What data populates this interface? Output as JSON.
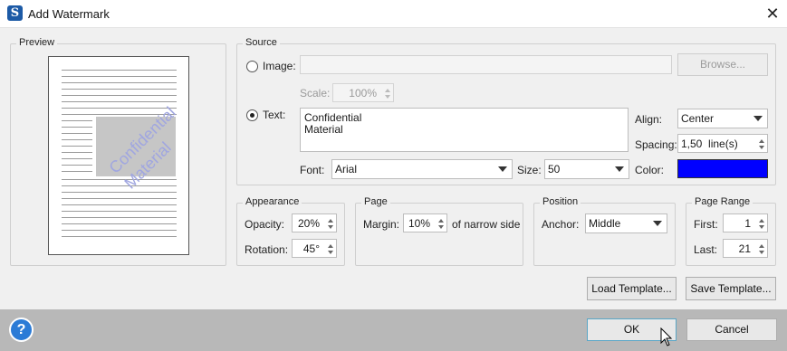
{
  "window": {
    "title": "Add Watermark",
    "app_icon_glyph": "S"
  },
  "preview": {
    "legend": "Preview",
    "watermark_lines": [
      "Confidential",
      "Material"
    ],
    "watermark_color": "#a0a6e0"
  },
  "source": {
    "legend": "Source",
    "image_label": "Image:",
    "image_path": "",
    "browse_label": "Browse...",
    "scale_label": "Scale:",
    "scale_value": "100%",
    "text_label": "Text:",
    "text_value": "Confidential\nMaterial",
    "align_label": "Align:",
    "align_value": "Center",
    "spacing_label": "Spacing:",
    "spacing_value": "1,50  line(s)",
    "font_label": "Font:",
    "font_value": "Arial",
    "size_label": "Size:",
    "size_value": "50",
    "color_label": "Color:",
    "color_value": "#0000ff",
    "selected_source": "text"
  },
  "appearance": {
    "legend": "Appearance",
    "opacity_label": "Opacity:",
    "opacity_value": "20%",
    "rotation_label": "Rotation:",
    "rotation_value": "45°"
  },
  "page": {
    "legend": "Page",
    "margin_label": "Margin:",
    "margin_value": "10%",
    "margin_suffix": "of narrow side"
  },
  "position": {
    "legend": "Position",
    "anchor_label": "Anchor:",
    "anchor_value": "Middle"
  },
  "page_range": {
    "legend": "Page Range",
    "first_label": "First:",
    "first_value": "1",
    "last_label": "Last:",
    "last_value": "21"
  },
  "templates": {
    "load_label": "Load Template...",
    "save_label": "Save Template..."
  },
  "footer": {
    "help_glyph": "?",
    "ok_label": "OK",
    "cancel_label": "Cancel"
  },
  "icons": [
    "app-icon",
    "close-icon",
    "help-icon",
    "mouse-cursor-icon"
  ]
}
